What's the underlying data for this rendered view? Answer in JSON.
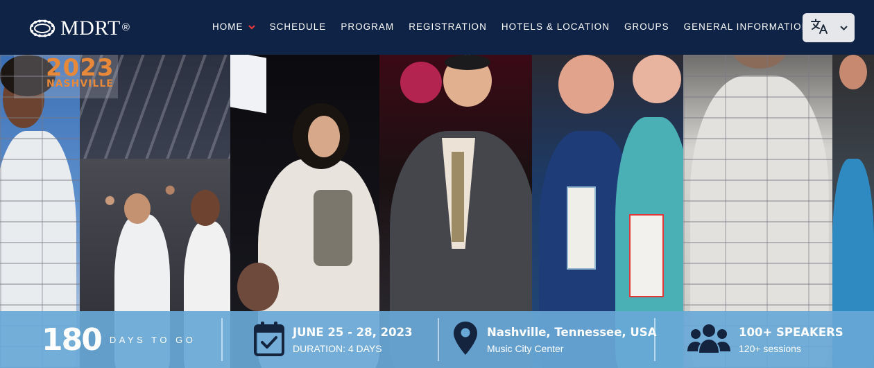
{
  "brand": {
    "name": "MDRT",
    "registered": "®"
  },
  "nav": {
    "items": [
      {
        "label": "HOME",
        "has_dropdown": true
      },
      {
        "label": "SCHEDULE",
        "has_dropdown": false
      },
      {
        "label": "PROGRAM",
        "has_dropdown": false
      },
      {
        "label": "REGISTRATION",
        "has_dropdown": false
      },
      {
        "label": "HOTELS & LOCATION",
        "has_dropdown": false
      },
      {
        "label": "GROUPS",
        "has_dropdown": false
      },
      {
        "label": "GENERAL INFORMATION",
        "has_dropdown": true
      }
    ],
    "dropdown_color": "#e5393b",
    "language_icon": "translate-icon"
  },
  "hero": {
    "badge_year": "2023",
    "badge_city": "NASHVILLE",
    "badge_color": "#e8893a"
  },
  "info": {
    "countdown": {
      "value": "180",
      "label": "DAYS TO GO"
    },
    "dates": {
      "title": "JUNE 25 - 28, 2023",
      "subtitle": "DURATION: 4 DAYS",
      "icon": "calendar-check-icon"
    },
    "location": {
      "title": "Nashville, Tennessee, USA",
      "subtitle": "Music City Center",
      "icon": "map-pin-icon"
    },
    "speakers": {
      "title": "100+ SPEAKERS",
      "subtitle": "120+ sessions",
      "icon": "users-icon"
    },
    "bar_color": "#68a8d7",
    "icon_color": "#14243f"
  }
}
